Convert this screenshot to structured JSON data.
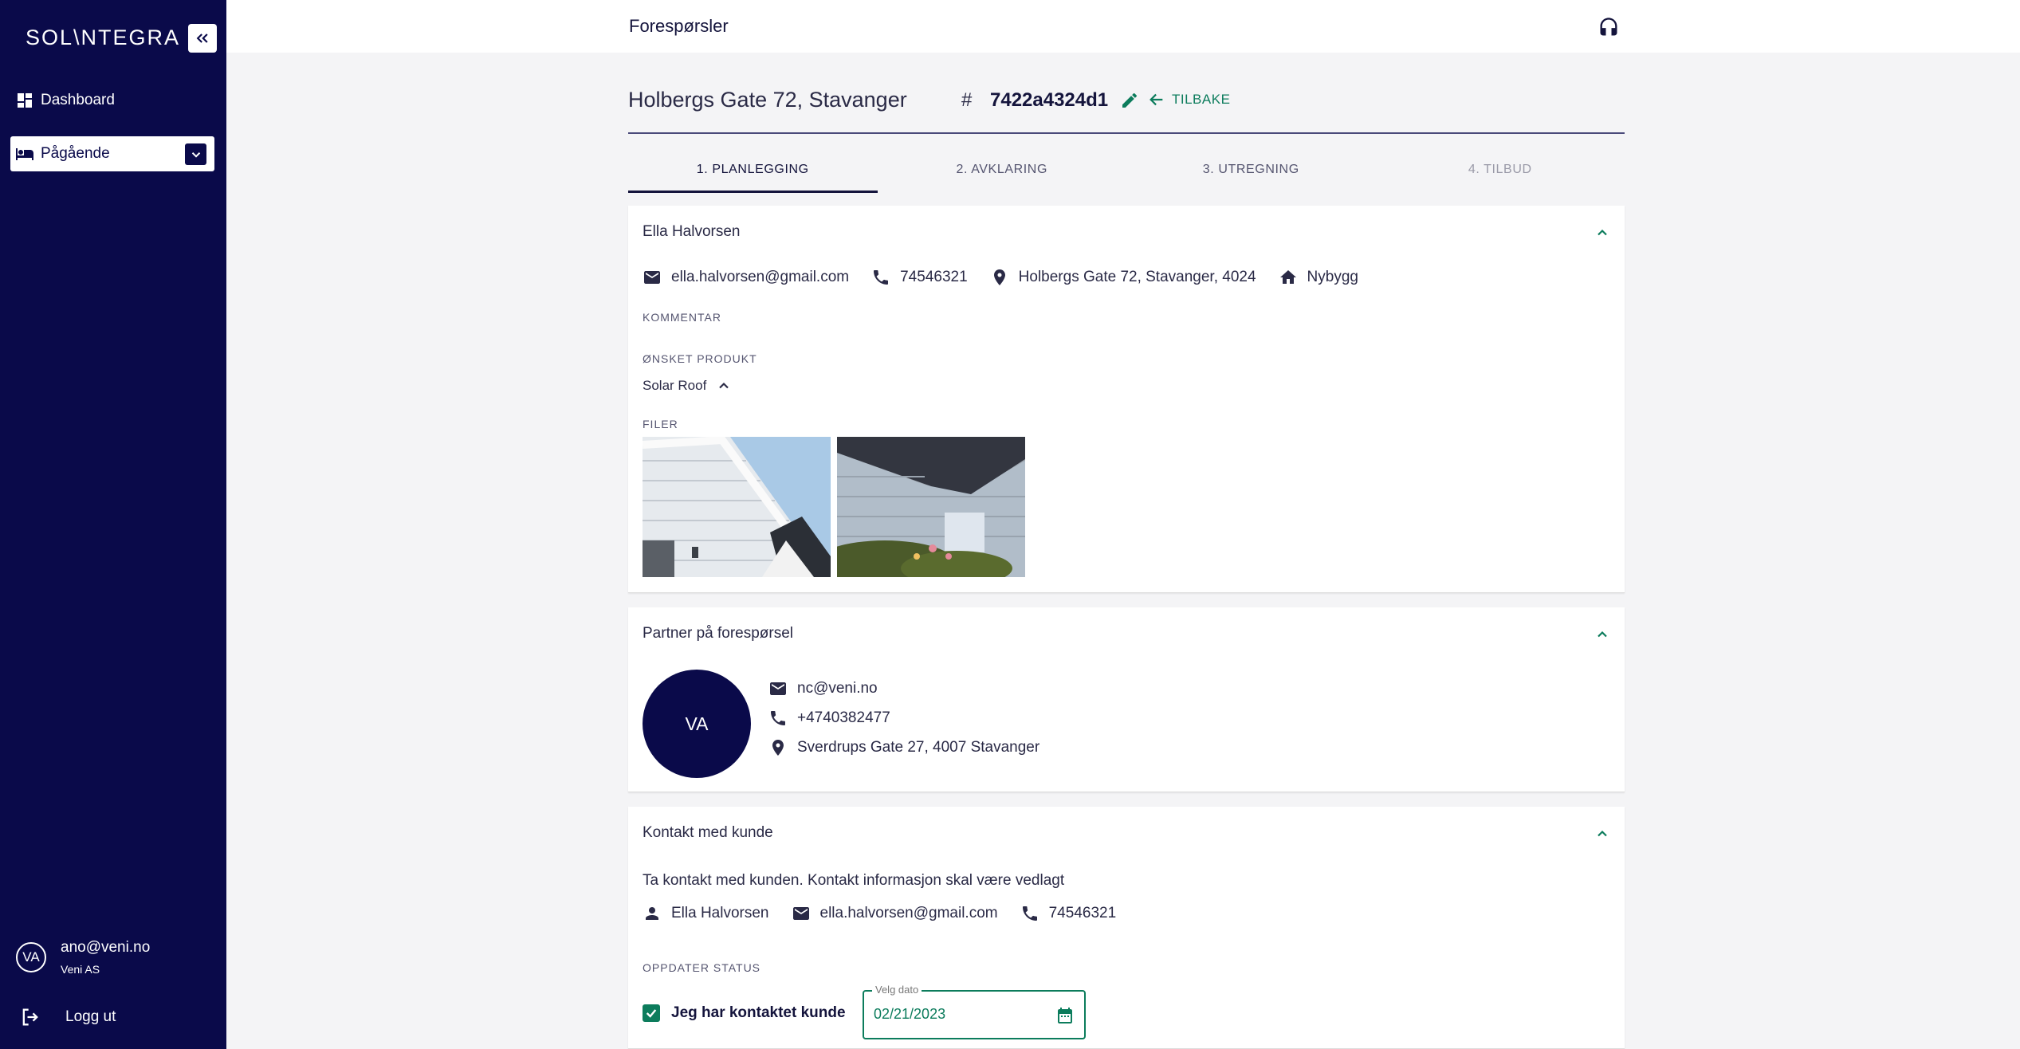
{
  "sidebar": {
    "logo": "SOL\\NTEGRA",
    "nav": {
      "dashboard": "Dashboard",
      "ongoing": "Pågående"
    },
    "user": {
      "initials": "VA",
      "email": "ano@veni.no",
      "org": "Veni AS"
    },
    "logout": "Logg ut"
  },
  "topbar": {
    "title": "Forespørsler"
  },
  "case": {
    "address": "Holbergs Gate 72, Stavanger",
    "hash": "#",
    "id": "7422a4324d1",
    "back_label": "TILBAKE"
  },
  "steps": [
    {
      "label": "1. PLANLEGGING"
    },
    {
      "label": "2. AVKLARING"
    },
    {
      "label": "3. UTREGNING"
    },
    {
      "label": "4. TILBUD"
    }
  ],
  "customer_card": {
    "title": "Ella Halvorsen",
    "email": "ella.halvorsen@gmail.com",
    "phone": "74546321",
    "address": "Holbergs Gate 72, Stavanger, 4024",
    "building_type": "Nybygg",
    "comment_label": "KOMMENTAR",
    "product_label": "ØNSKET PRODUKT",
    "product_value": "Solar Roof",
    "files_label": "FILER"
  },
  "partner_card": {
    "title": "Partner på forespørsel",
    "initials": "VA",
    "email": "nc@veni.no",
    "phone": "+4740382477",
    "address": "Sverdrups Gate 27, 4007 Stavanger"
  },
  "contact_card": {
    "title": "Kontakt med kunde",
    "description": "Ta kontakt med kunden. Kontakt informasjon skal være vedlagt",
    "name": "Ella Halvorsen",
    "email": "ella.halvorsen@gmail.com",
    "phone": "74546321",
    "status_label": "OPPDATER STATUS",
    "checkbox_label": "Jeg har kontaktet kunde",
    "date_label": "Velg dato",
    "date_value": "02/21/2023"
  },
  "colors": {
    "sidebar_bg": "#0a0a4a",
    "accent_green": "#0c7c5c",
    "text_dark": "#14143c"
  }
}
